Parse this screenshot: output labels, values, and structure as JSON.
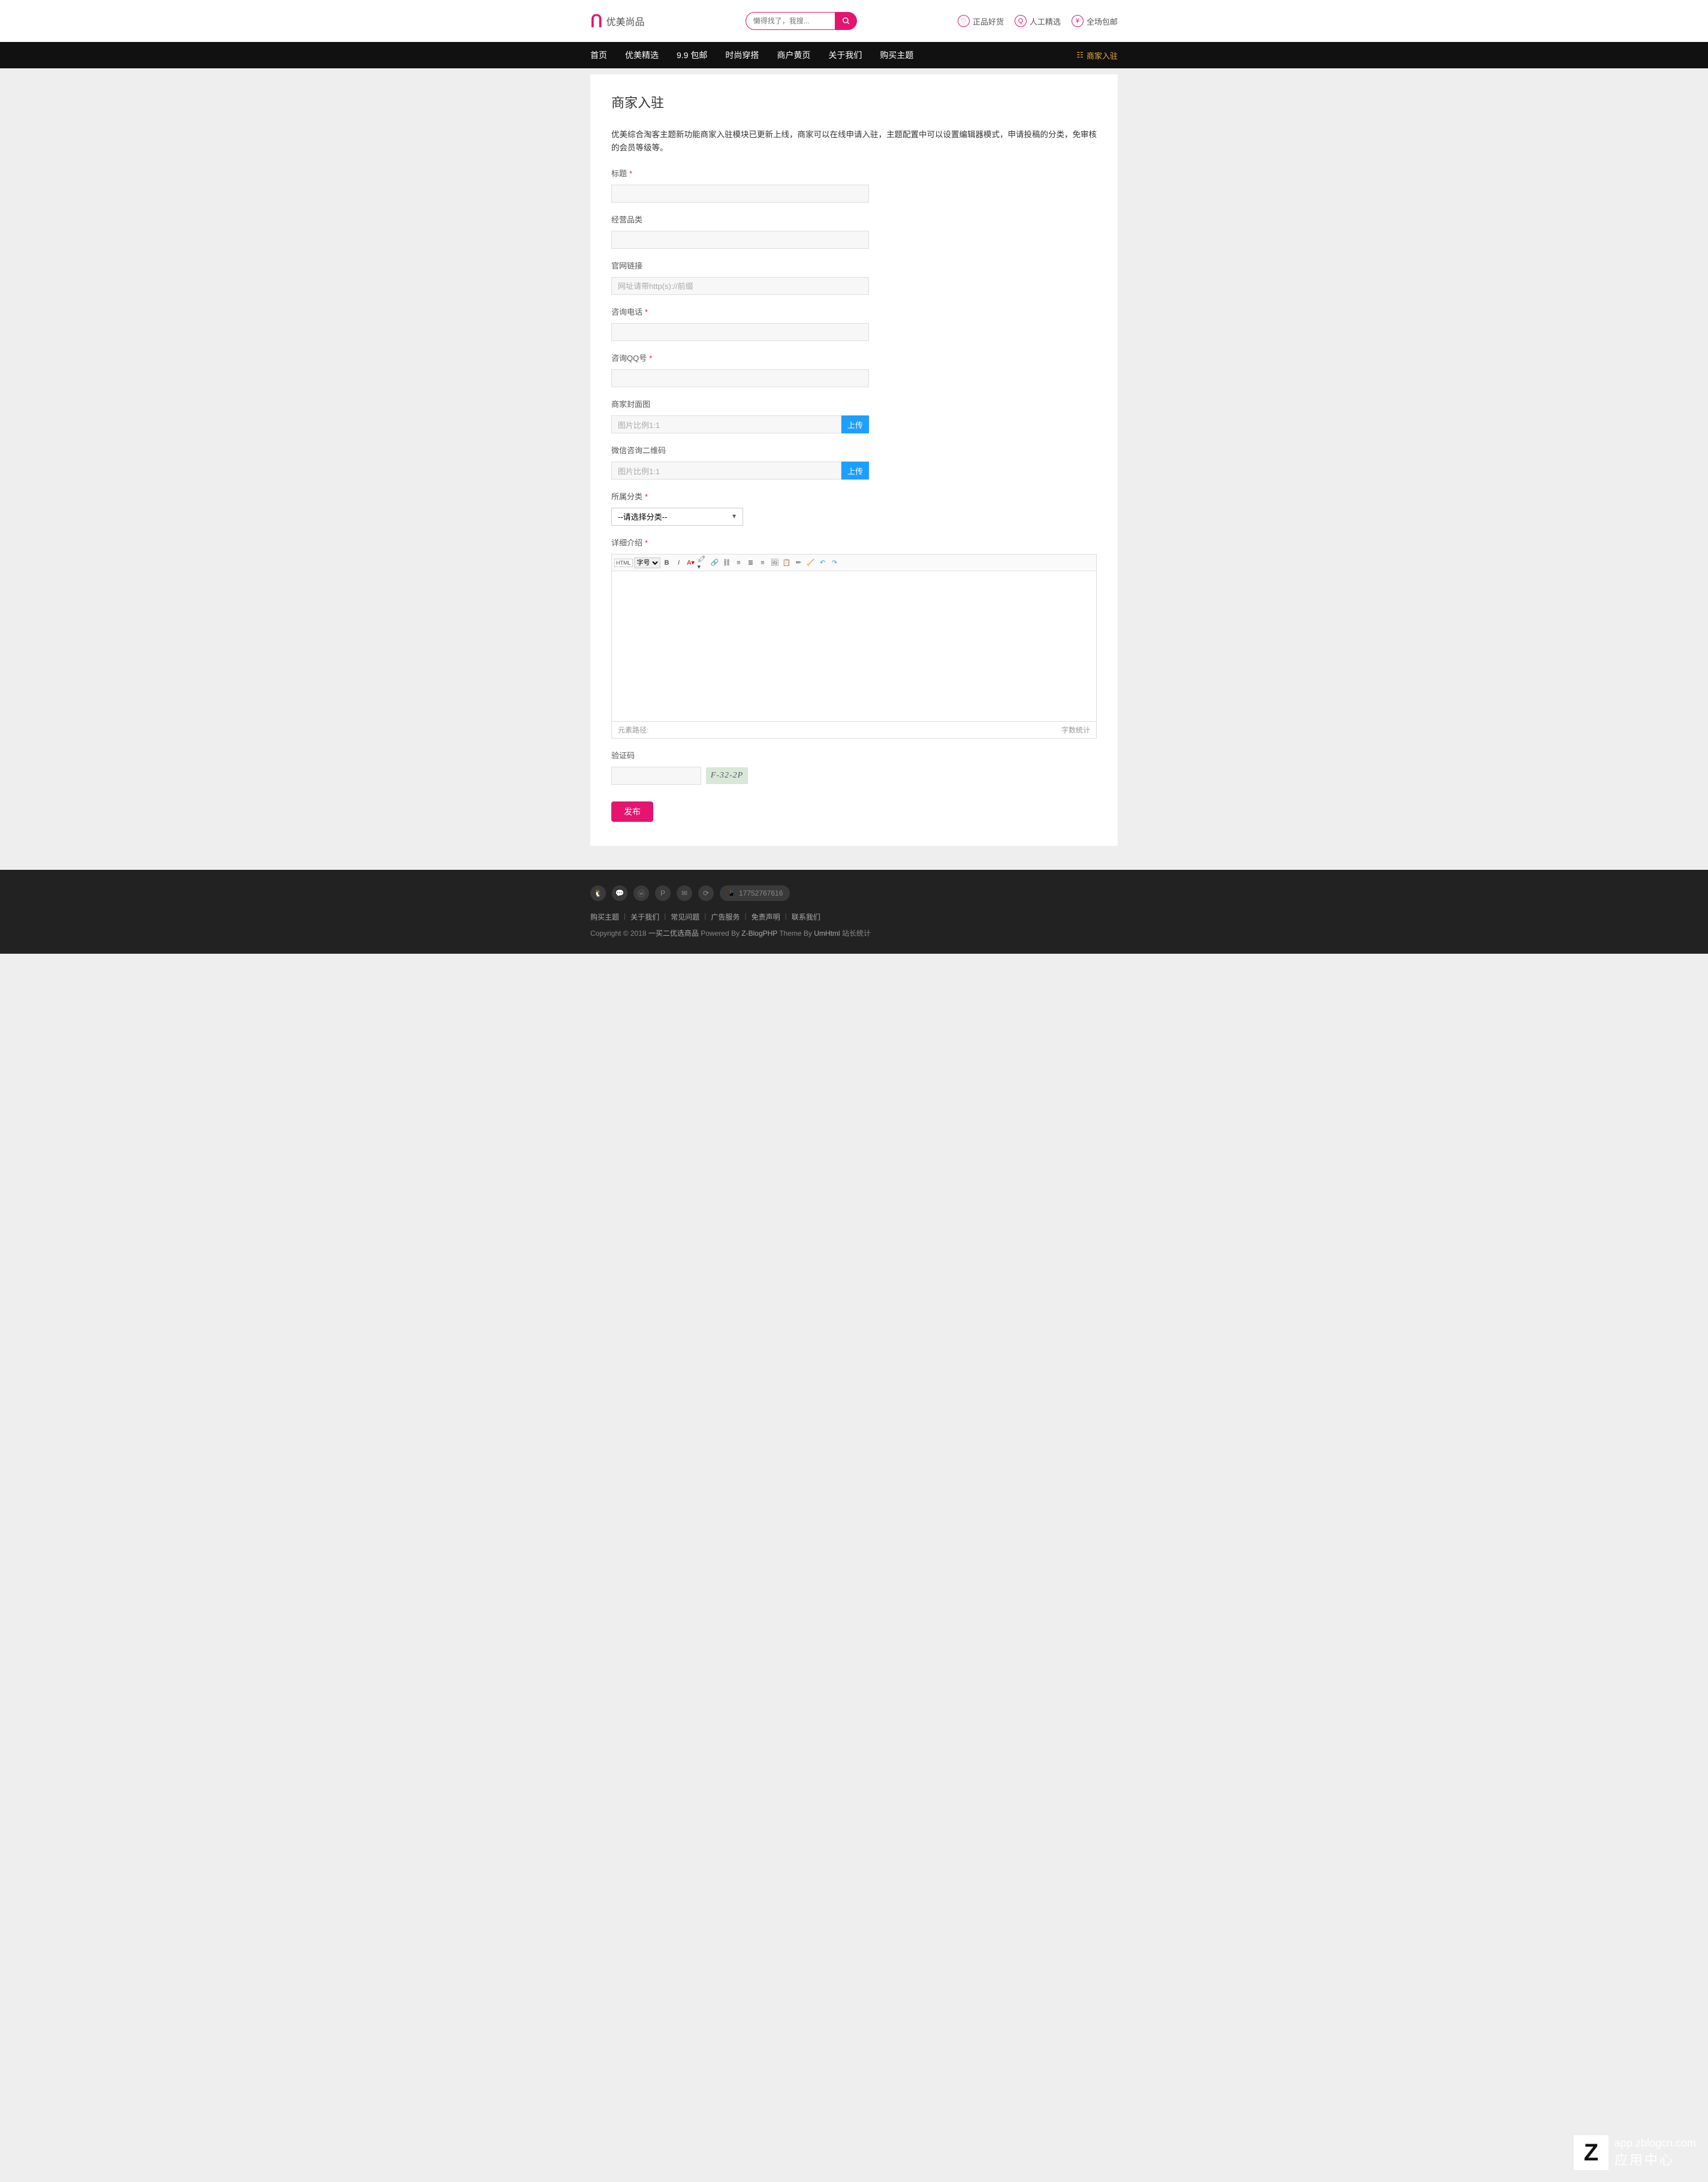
{
  "header": {
    "logo_text": "优美尚品",
    "search_placeholder": "懒得找了，我搜...",
    "links": [
      {
        "label": "正品好货"
      },
      {
        "label": "人工精选"
      },
      {
        "label": "全场包邮"
      }
    ]
  },
  "nav": {
    "items": [
      "首页",
      "优美精选",
      "9.9 包邮",
      "时尚穿搭",
      "商户黄页",
      "关于我们",
      "购买主题"
    ],
    "merchant": "商家入驻"
  },
  "page": {
    "title": "商家入驻",
    "intro": "优美综合淘客主题新功能商家入驻模块已更新上线，商家可以在线申请入驻，主题配置中可以设置编辑器模式，申请投稿的分类，免审核的会员等级等。"
  },
  "form": {
    "title_label": "标题",
    "category_label": "经营品类",
    "website_label": "官网链接",
    "website_placeholder": "网址请带http(s)://前缀",
    "phone_label": "咨询电话",
    "qq_label": "咨询QQ号",
    "cover_label": "商家封面图",
    "cover_placeholder": "图片比例1:1",
    "wechat_label": "微信咨询二维码",
    "wechat_placeholder": "图片比例1:1",
    "upload_btn": "上传",
    "class_label": "所属分类",
    "class_placeholder": "--请选择分类--",
    "detail_label": "详细介绍",
    "captcha_label": "验证码",
    "captcha_text": "F-32-2P",
    "submit": "发布"
  },
  "editor": {
    "font_label": "字号",
    "path_label": "元素路径:",
    "wordcount": "字数统计"
  },
  "footer": {
    "phone": "17752767616",
    "links": [
      "购买主题",
      "关于我们",
      "常见问题",
      "广告服务",
      "免责声明",
      "联系我们"
    ],
    "copyright_prefix": "Copyright © 2018 ",
    "site_name": "一买二优选商品",
    "powered": " Powered By ",
    "powered_link": "Z-BlogPHP",
    "theme": " Theme By ",
    "theme_link": "UmHtml",
    "stats": " 站长统计"
  },
  "watermark": {
    "url": "app.zblogcn.com",
    "text": "应用中心"
  }
}
